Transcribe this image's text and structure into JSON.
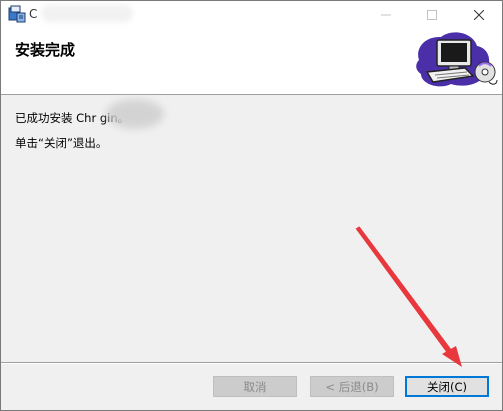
{
  "window": {
    "title_visible": "C",
    "controls": {
      "minimize": "—",
      "maximize": "☐",
      "close": "✕"
    }
  },
  "header": {
    "title": "安装完成",
    "art_icon": "computer-disk-icon"
  },
  "content": {
    "line1": "已成功安装 Chr     gin。",
    "line2": "单击“关闭”退出。"
  },
  "buttons": {
    "cancel": "取消",
    "back": "< 后退(B)",
    "close": "关闭(C)"
  },
  "colors": {
    "focus_border": "#0078d7",
    "annotation_arrow": "#e8383d"
  }
}
